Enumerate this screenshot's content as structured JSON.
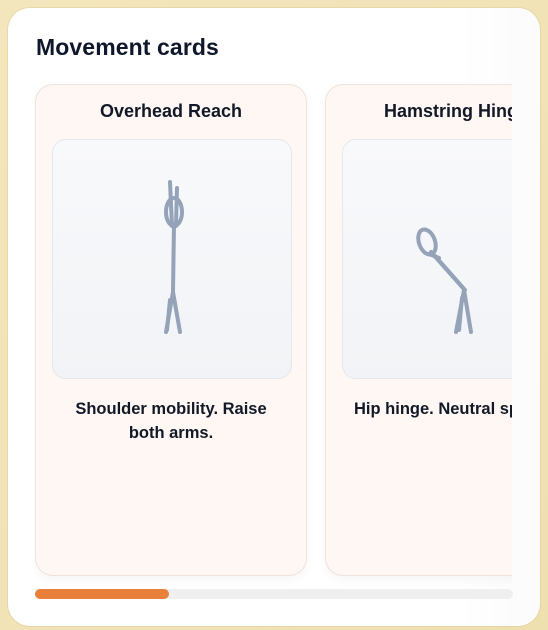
{
  "section": {
    "title": "Movement cards"
  },
  "cards": [
    {
      "title": "Overhead Reach",
      "description": "Shoulder mobility. Raise both arms."
    },
    {
      "title": "Hamstring Hinge",
      "description": "Hip hinge. Neutral spine."
    }
  ],
  "scrollbar": {
    "progress": 0.28
  },
  "colors": {
    "accent": "#e8803a",
    "figure_stroke": "#94a3b8",
    "card_bg": "#fff7f3",
    "page_bg": "#f3e4b6"
  }
}
